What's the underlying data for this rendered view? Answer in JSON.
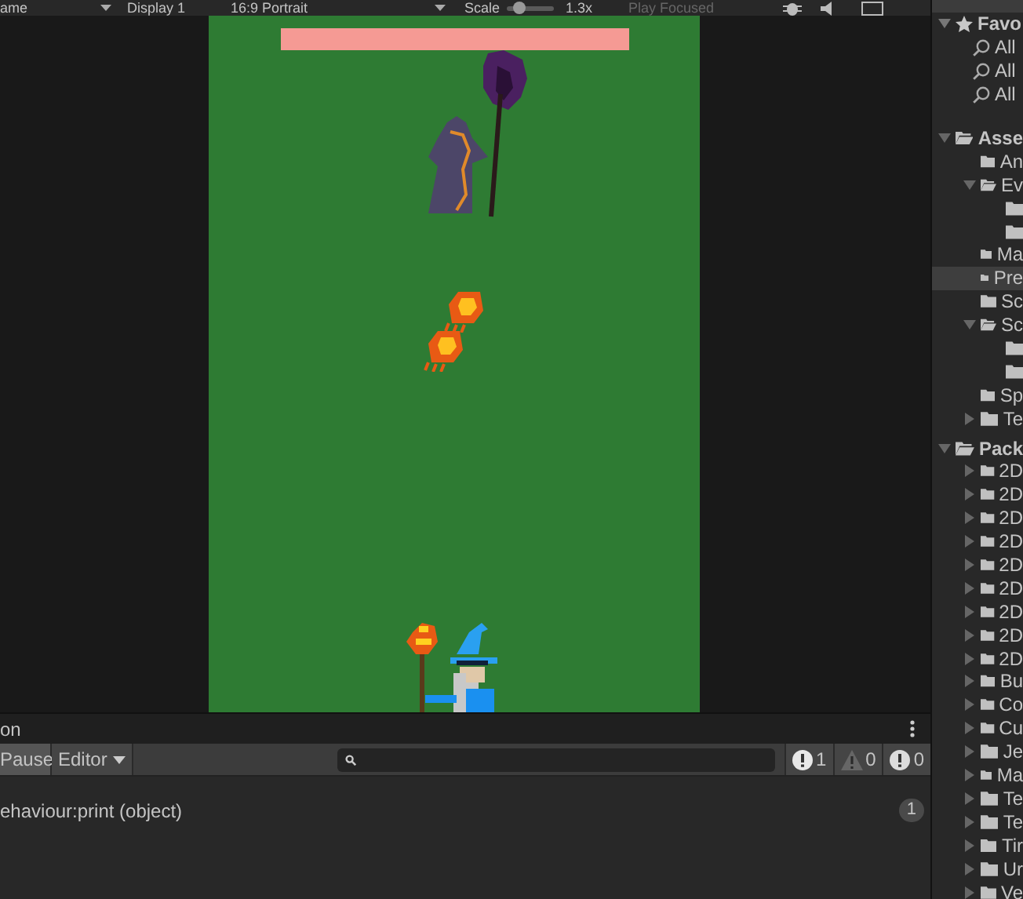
{
  "toolbar": {
    "view_label": "ame",
    "display": "Display 1",
    "aspect": "16:9 Portrait",
    "scale_label": "Scale",
    "scale_slider": {
      "level": 0.2
    },
    "scale_value": "1.3x",
    "play_mode": "Play Focused"
  },
  "console": {
    "title": "on",
    "pause": "Pause",
    "editor": "Editor",
    "counts": [
      {
        "kind": "info",
        "count": "1"
      },
      {
        "kind": "warning",
        "count": "0"
      },
      {
        "kind": "error",
        "count": "0"
      }
    ],
    "logs": [
      {
        "text": "ehaviour:print (object)",
        "count": "1"
      }
    ]
  },
  "project": {
    "favorites": {
      "label": "Favo",
      "expanded": true,
      "items": [
        "All",
        "All",
        "All"
      ]
    },
    "tree": [
      {
        "label": "Asse",
        "expanded": true,
        "selected": false,
        "children": [
          {
            "label": "An",
            "selected": false
          },
          {
            "label": "Ev",
            "expanded": true,
            "selected": false,
            "children": [
              {
                "selected": false
              },
              {
                "selected": false
              }
            ]
          },
          {
            "label": "Ma",
            "selected": false
          },
          {
            "label": "Pre",
            "selected": true
          },
          {
            "label": "Sc",
            "selected": false
          },
          {
            "label": "Sc",
            "expanded": true,
            "selected": false,
            "children": [
              {
                "selected": false
              },
              {
                "selected": false
              }
            ]
          },
          {
            "label": "Sp",
            "selected": false
          },
          {
            "label": "Te",
            "expanded": false,
            "selected": false
          }
        ]
      },
      {
        "label": "Pack",
        "expanded": true,
        "selected": false,
        "children": [
          {
            "label": "2D",
            "expanded": false,
            "selected": false
          },
          {
            "label": "2D",
            "expanded": false,
            "selected": false
          },
          {
            "label": "2D",
            "expanded": false,
            "selected": false
          },
          {
            "label": "2D",
            "expanded": false,
            "selected": false
          },
          {
            "label": "2D",
            "expanded": false,
            "selected": false
          },
          {
            "label": "2D",
            "expanded": false,
            "selected": false
          },
          {
            "label": "2D",
            "expanded": false,
            "selected": false
          },
          {
            "label": "2D",
            "expanded": false,
            "selected": false
          },
          {
            "label": "2D",
            "expanded": false,
            "selected": false
          },
          {
            "label": "Bu",
            "expanded": false,
            "selected": false
          },
          {
            "label": "Co",
            "expanded": false,
            "selected": false
          },
          {
            "label": "Cu",
            "expanded": false,
            "selected": false
          },
          {
            "label": "Je",
            "expanded": false,
            "selected": false
          },
          {
            "label": "Ma",
            "expanded": false,
            "selected": false
          },
          {
            "label": "Te",
            "expanded": false,
            "selected": false
          },
          {
            "label": "Te",
            "expanded": false,
            "selected": false
          },
          {
            "label": "Tir",
            "expanded": false,
            "selected": false
          },
          {
            "label": "Ur",
            "expanded": false,
            "selected": false
          },
          {
            "label": "Ve",
            "expanded": false,
            "selected": false
          }
        ]
      }
    ]
  }
}
